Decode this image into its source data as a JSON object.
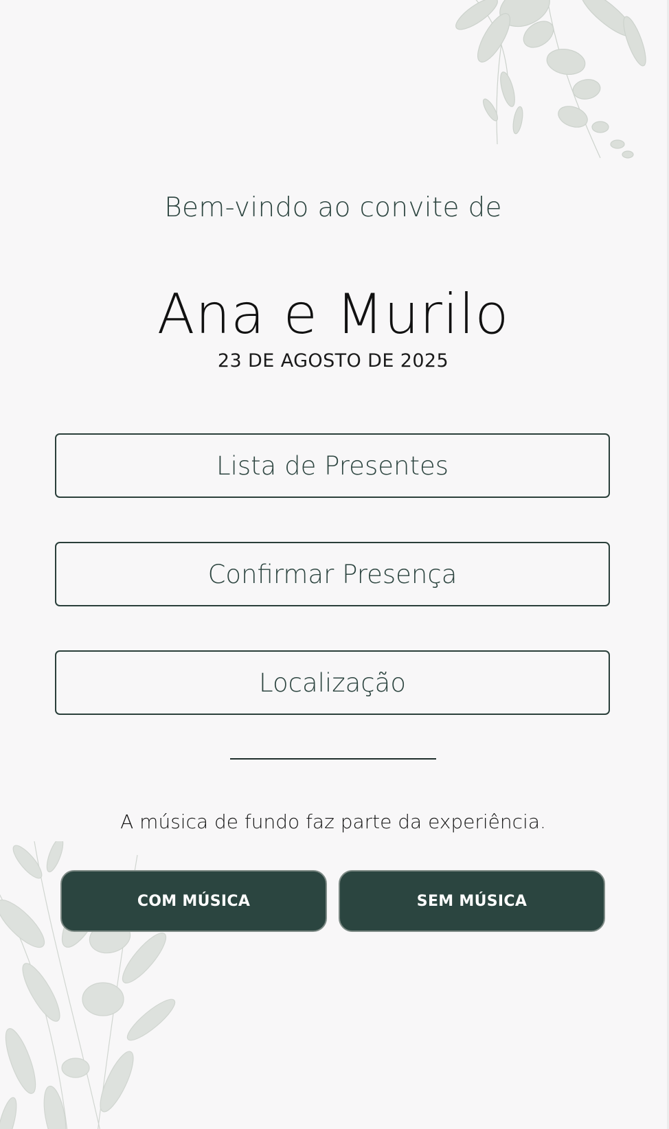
{
  "header": {
    "welcome_text": "Bem-vindo ao convite de",
    "couple_names": "Ana e Murilo",
    "date": "23 DE AGOSTO DE 2025"
  },
  "menu": {
    "items": [
      {
        "label": "Lista de Presentes"
      },
      {
        "label": "Confirmar Presença"
      },
      {
        "label": "Localização"
      }
    ]
  },
  "music": {
    "note": "A música de fundo faz parte da experiência.",
    "with_music_label": "COM MÚSICA",
    "without_music_label": "SEM MÚSICA"
  },
  "decor": {
    "top_icon": "eucalyptus-foliage-icon",
    "bottom_icon": "eucalyptus-foliage-icon"
  },
  "colors": {
    "background": "#f8f7f8",
    "accent": "#2b4540",
    "text_dark": "#2d4540",
    "foliage": "#b9c3b9"
  }
}
